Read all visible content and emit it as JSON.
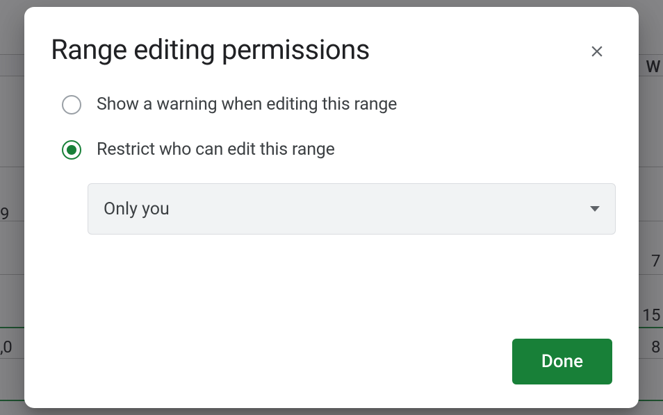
{
  "dialog": {
    "title": "Range editing permissions",
    "options": {
      "warning": {
        "label": "Show a warning when editing this range",
        "selected": false
      },
      "restrict": {
        "label": "Restrict who can edit this range",
        "selected": true
      }
    },
    "restrict_select": {
      "value": "Only you"
    },
    "done_label": "Done"
  },
  "background": {
    "cells": {
      "left1": "9",
      "left2": ",0",
      "right_header": "W",
      "right1": "7",
      "right2": "15",
      "right3": "8"
    }
  }
}
